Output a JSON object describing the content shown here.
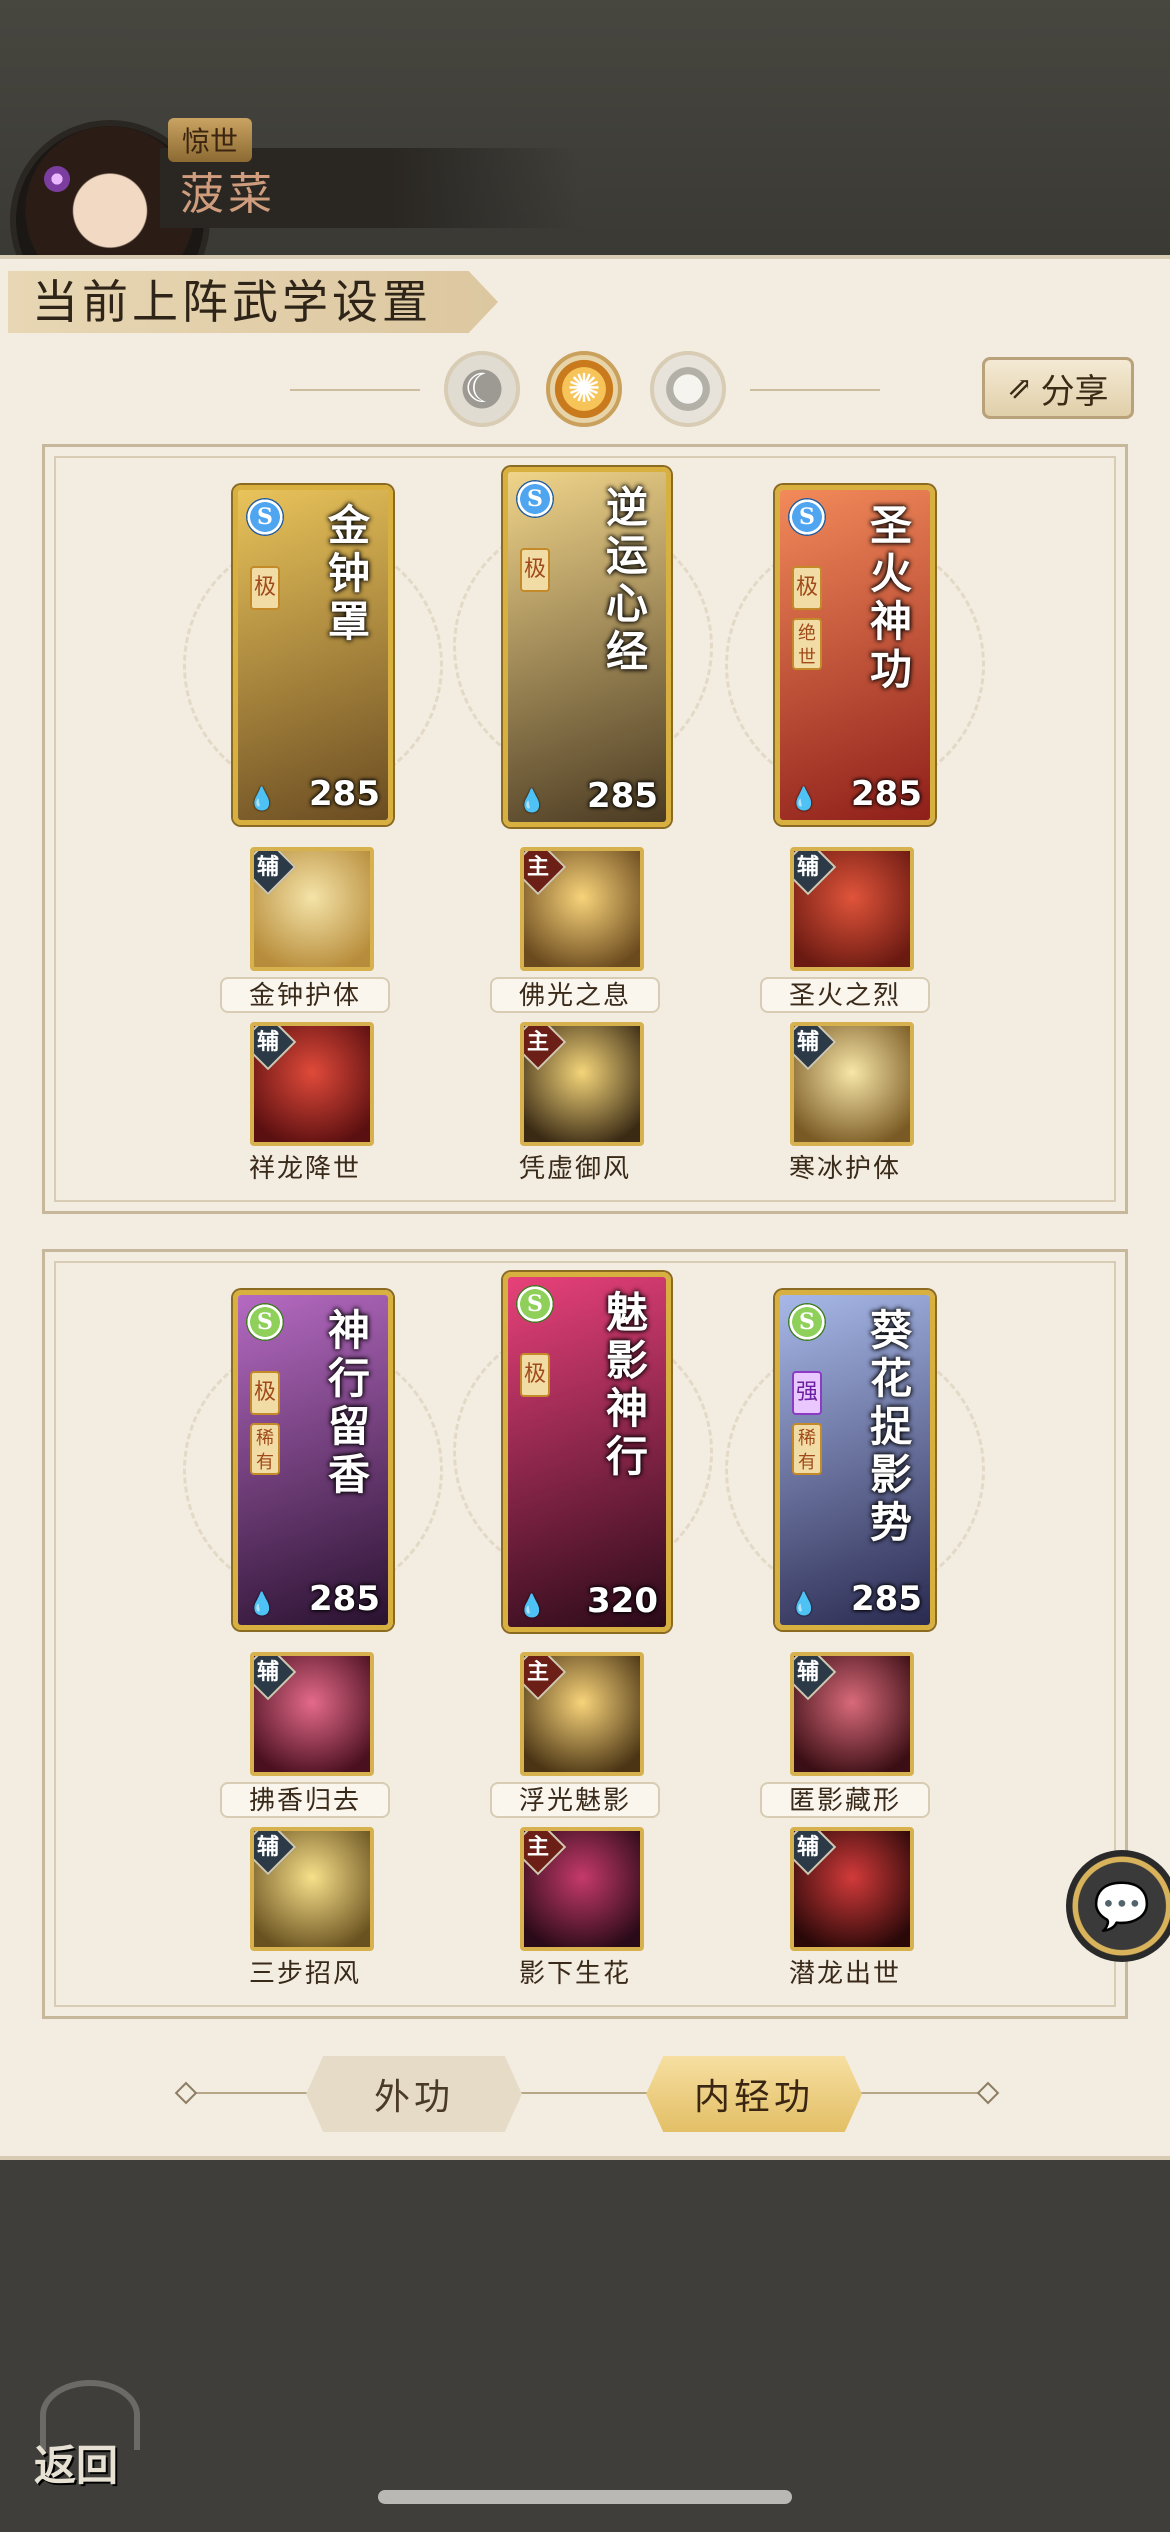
{
  "header": {
    "title_badge": "惊世",
    "player_name": "菠菜"
  },
  "panel": {
    "title": "当前上阵武学设置",
    "phases": [
      "moon-icon",
      "sun-icon",
      "ring-icon"
    ],
    "share_label": "分享"
  },
  "sections": [
    {
      "cards": [
        {
          "name": "金钟罩",
          "rank": "极",
          "tag": "",
          "type": "S",
          "power": "285",
          "colors": [
            "#e9c35a",
            "#6a4c22"
          ]
        },
        {
          "name": "逆运心经",
          "rank": "极",
          "tag": "",
          "type": "S",
          "power": "285",
          "colors": [
            "#f0d48a",
            "#4a3a22"
          ]
        },
        {
          "name": "圣火神功",
          "rank": "极",
          "tag": "绝世",
          "type": "S",
          "power": "285",
          "colors": [
            "#f28a5a",
            "#8e1f1a"
          ]
        }
      ],
      "skills": [
        {
          "badge": "辅",
          "label": "金钟护体",
          "colors": [
            "#f4e3a8",
            "#b78c3a"
          ]
        },
        {
          "badge": "主",
          "label": "佛光之息",
          "colors": [
            "#f7d37a",
            "#6b4a1e"
          ]
        },
        {
          "badge": "辅",
          "label": "圣火之烈",
          "colors": [
            "#e0543a",
            "#6b1a12"
          ]
        },
        {
          "badge": "辅",
          "label": "祥龙降世",
          "colors": [
            "#e04a3a",
            "#5a0f10"
          ]
        },
        {
          "badge": "主",
          "label": "凭虚御风",
          "colors": [
            "#f4d57a",
            "#3a2a14"
          ]
        },
        {
          "badge": "辅",
          "label": "寒冰护体",
          "colors": [
            "#f7e6a8",
            "#7a5a24"
          ]
        }
      ]
    },
    {
      "cards": [
        {
          "name": "神行留香",
          "rank": "极",
          "tag": "稀有",
          "type": "S",
          "power": "285",
          "colors": [
            "#b56ac2",
            "#2a1230"
          ]
        },
        {
          "name": "魅影神行",
          "rank": "极",
          "tag": "",
          "type": "S",
          "power": "320",
          "colors": [
            "#e8417a",
            "#2a0a18"
          ]
        },
        {
          "name": "葵花捉影势",
          "rank": "强",
          "tag": "稀有",
          "type": "S",
          "power": "285",
          "colors": [
            "#a7b8e8",
            "#2a2a50"
          ]
        }
      ],
      "skills": [
        {
          "badge": "辅",
          "label": "拂香归去",
          "colors": [
            "#e46a8a",
            "#4a1020"
          ]
        },
        {
          "badge": "主",
          "label": "浮光魅影",
          "colors": [
            "#f7d37a",
            "#4a3414"
          ]
        },
        {
          "badge": "辅",
          "label": "匿影藏形",
          "colors": [
            "#d86a7a",
            "#3a0e14"
          ]
        },
        {
          "badge": "辅",
          "label": "三步招风",
          "colors": [
            "#f7e08a",
            "#6a5220"
          ]
        },
        {
          "badge": "主",
          "label": "影下生花",
          "colors": [
            "#c53a6a",
            "#2a0a18"
          ]
        },
        {
          "badge": "辅",
          "label": "潜龙出世",
          "colors": [
            "#d23a3a",
            "#2a0808"
          ]
        }
      ]
    }
  ],
  "tabs": {
    "outer": "外功",
    "inner": "内轻功"
  },
  "chat_icon": "chat-bubble-icon",
  "back_label": "返回"
}
